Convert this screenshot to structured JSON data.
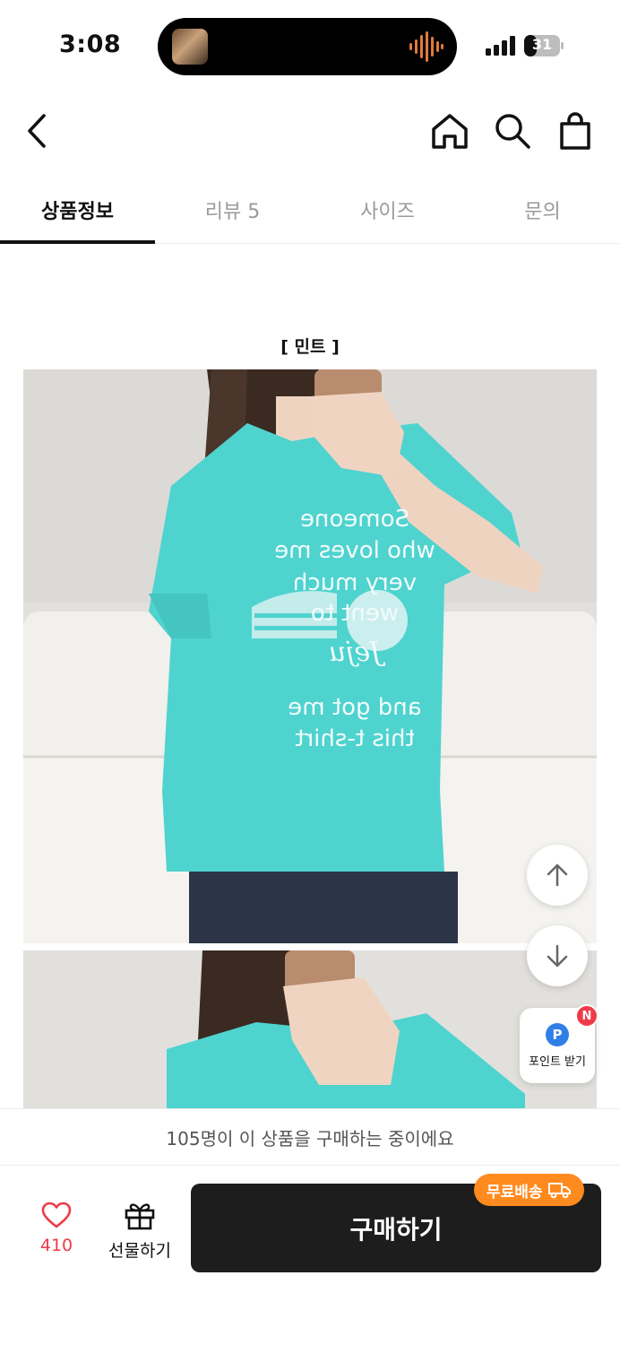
{
  "status_bar": {
    "time": "3:08",
    "battery": "31"
  },
  "tabs": [
    {
      "label": "상품정보",
      "active": true
    },
    {
      "label": "리뷰 5",
      "active": false
    },
    {
      "label": "사이즈",
      "active": false
    },
    {
      "label": "문의",
      "active": false
    }
  ],
  "product": {
    "color_caption": "[ 민트 ]",
    "shirt_print": [
      "Someone",
      "who loves me",
      "very much",
      "went to",
      "Jeju",
      "and got me",
      "this t-shirt"
    ]
  },
  "floating": {
    "point_label": "포인트 받기",
    "point_letter": "P",
    "new_badge": "N"
  },
  "notice": "105명이 이 상품을 구매하는 중이에요",
  "bottom_bar": {
    "like_count": "410",
    "gift_label": "선물하기",
    "buy_label": "구매하기",
    "shipping_badge": "무료배송"
  },
  "colors": {
    "accent_red": "#ef3b48",
    "shipping_orange": "#ff8a1e",
    "buy_button": "#1d1d1d",
    "shirt_mint": "#4fd3cf"
  }
}
